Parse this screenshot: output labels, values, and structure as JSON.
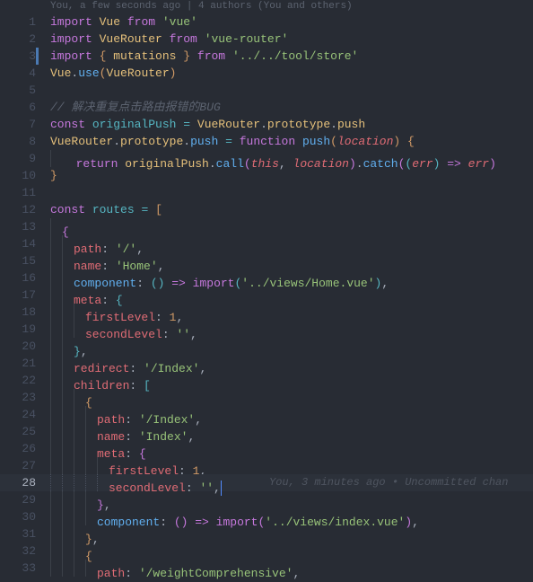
{
  "codelens": "You, a few seconds ago | 4 authors (You and others)",
  "blame_line28": "You, 3 minutes ago • Uncommitted chan",
  "lines": {
    "1": [
      [
        "kw",
        "import"
      ],
      [
        "plain",
        " "
      ],
      [
        "var",
        "Vue"
      ],
      [
        "plain",
        " "
      ],
      [
        "kw",
        "from"
      ],
      [
        "plain",
        " "
      ],
      [
        "str",
        "'vue'"
      ]
    ],
    "2": [
      [
        "kw",
        "import"
      ],
      [
        "plain",
        " "
      ],
      [
        "var",
        "VueRouter"
      ],
      [
        "plain",
        " "
      ],
      [
        "kw",
        "from"
      ],
      [
        "plain",
        " "
      ],
      [
        "str",
        "'vue-router'"
      ]
    ],
    "3": [
      [
        "kw",
        "import"
      ],
      [
        "plain",
        " "
      ],
      [
        "brace-y",
        "{"
      ],
      [
        "plain",
        " "
      ],
      [
        "var",
        "mutations"
      ],
      [
        "plain",
        " "
      ],
      [
        "brace-y",
        "}"
      ],
      [
        "plain",
        " "
      ],
      [
        "kw",
        "from"
      ],
      [
        "plain",
        " "
      ],
      [
        "str",
        "'../../tool/store'"
      ]
    ],
    "4": [
      [
        "var",
        "Vue"
      ],
      [
        "punc",
        "."
      ],
      [
        "func",
        "use"
      ],
      [
        "brace-y",
        "("
      ],
      [
        "var",
        "VueRouter"
      ],
      [
        "brace-y",
        ")"
      ]
    ],
    "5": [],
    "6": [
      [
        "comment",
        "// 解决重复点击路由报错的BUG"
      ]
    ],
    "7": [
      [
        "kw",
        "const"
      ],
      [
        "plain",
        " "
      ],
      [
        "prop",
        "originalPush"
      ],
      [
        "plain",
        " "
      ],
      [
        "op",
        "="
      ],
      [
        "plain",
        " "
      ],
      [
        "var",
        "VueRouter"
      ],
      [
        "punc",
        "."
      ],
      [
        "var",
        "prototype"
      ],
      [
        "punc",
        "."
      ],
      [
        "var",
        "push"
      ]
    ],
    "8": [
      [
        "var",
        "VueRouter"
      ],
      [
        "punc",
        "."
      ],
      [
        "var",
        "prototype"
      ],
      [
        "punc",
        "."
      ],
      [
        "func",
        "push"
      ],
      [
        "plain",
        " "
      ],
      [
        "op",
        "="
      ],
      [
        "plain",
        " "
      ],
      [
        "kw",
        "function"
      ],
      [
        "plain",
        " "
      ],
      [
        "func",
        "push"
      ],
      [
        "brace-y",
        "("
      ],
      [
        "param",
        "location"
      ],
      [
        "brace-y",
        ")"
      ],
      [
        "plain",
        " "
      ],
      [
        "brace-y",
        "{"
      ]
    ],
    "9": [
      [
        "plain",
        "  "
      ],
      [
        "kw",
        "return"
      ],
      [
        "plain",
        " "
      ],
      [
        "var",
        "originalPush"
      ],
      [
        "punc",
        "."
      ],
      [
        "func",
        "call"
      ],
      [
        "brace-p",
        "("
      ],
      [
        "this",
        "this"
      ],
      [
        "punc",
        ", "
      ],
      [
        "param",
        "location"
      ],
      [
        "brace-p",
        ")"
      ],
      [
        "punc",
        "."
      ],
      [
        "func",
        "catch"
      ],
      [
        "brace-p",
        "("
      ],
      [
        "brace-b",
        "("
      ],
      [
        "param",
        "err"
      ],
      [
        "brace-b",
        ")"
      ],
      [
        "plain",
        " "
      ],
      [
        "kw",
        "=>"
      ],
      [
        "plain",
        " "
      ],
      [
        "param",
        "err"
      ],
      [
        "brace-p",
        ")"
      ]
    ],
    "10": [
      [
        "brace-y",
        "}"
      ]
    ],
    "11": [],
    "12": [
      [
        "kw",
        "const"
      ],
      [
        "plain",
        " "
      ],
      [
        "prop",
        "routes"
      ],
      [
        "plain",
        " "
      ],
      [
        "op",
        "="
      ],
      [
        "plain",
        " "
      ],
      [
        "brace-y",
        "["
      ]
    ],
    "13": [
      [
        "brace-p",
        "{"
      ]
    ],
    "14": [
      [
        "key",
        "path"
      ],
      [
        "punc",
        ": "
      ],
      [
        "str",
        "'/'"
      ],
      [
        "punc",
        ","
      ]
    ],
    "15": [
      [
        "key",
        "name"
      ],
      [
        "punc",
        ": "
      ],
      [
        "str",
        "'Home'"
      ],
      [
        "punc",
        ","
      ]
    ],
    "16": [
      [
        "func",
        "component"
      ],
      [
        "punc",
        ": "
      ],
      [
        "brace-b",
        "()"
      ],
      [
        "plain",
        " "
      ],
      [
        "kw",
        "=>"
      ],
      [
        "plain",
        " "
      ],
      [
        "kw",
        "import"
      ],
      [
        "brace-b",
        "("
      ],
      [
        "str",
        "'../views/Home.vue'"
      ],
      [
        "brace-b",
        ")"
      ],
      [
        "punc",
        ","
      ]
    ],
    "17": [
      [
        "key",
        "meta"
      ],
      [
        "punc",
        ": "
      ],
      [
        "brace-b",
        "{"
      ]
    ],
    "18": [
      [
        "key",
        "firstLevel"
      ],
      [
        "punc",
        ": "
      ],
      [
        "num",
        "1"
      ],
      [
        "punc",
        ","
      ]
    ],
    "19": [
      [
        "key",
        "secondLevel"
      ],
      [
        "punc",
        ": "
      ],
      [
        "str",
        "''"
      ],
      [
        "punc",
        ","
      ]
    ],
    "20": [
      [
        "brace-b",
        "}"
      ],
      [
        "punc",
        ","
      ]
    ],
    "21": [
      [
        "key",
        "redirect"
      ],
      [
        "punc",
        ": "
      ],
      [
        "str",
        "'/Index'"
      ],
      [
        "punc",
        ","
      ]
    ],
    "22": [
      [
        "key",
        "children"
      ],
      [
        "punc",
        ": "
      ],
      [
        "brace-b",
        "["
      ]
    ],
    "23": [
      [
        "brace-y",
        "{"
      ]
    ],
    "24": [
      [
        "key",
        "path"
      ],
      [
        "punc",
        ": "
      ],
      [
        "str",
        "'/Index'"
      ],
      [
        "punc",
        ","
      ]
    ],
    "25": [
      [
        "key",
        "name"
      ],
      [
        "punc",
        ": "
      ],
      [
        "str",
        "'Index'"
      ],
      [
        "punc",
        ","
      ]
    ],
    "26": [
      [
        "key",
        "meta"
      ],
      [
        "punc",
        ": "
      ],
      [
        "brace-p",
        "{"
      ]
    ],
    "27": [
      [
        "key",
        "firstLevel"
      ],
      [
        "punc",
        ": "
      ],
      [
        "num",
        "1"
      ],
      [
        "punc",
        ","
      ]
    ],
    "28": [
      [
        "key",
        "secondLevel"
      ],
      [
        "punc",
        ": "
      ],
      [
        "str",
        "''"
      ],
      [
        "punc",
        ","
      ]
    ],
    "29": [
      [
        "brace-p",
        "}"
      ],
      [
        "punc",
        ","
      ]
    ],
    "30": [
      [
        "func",
        "component"
      ],
      [
        "punc",
        ": "
      ],
      [
        "brace-p",
        "()"
      ],
      [
        "plain",
        " "
      ],
      [
        "kw",
        "=>"
      ],
      [
        "plain",
        " "
      ],
      [
        "kw",
        "import"
      ],
      [
        "brace-p",
        "("
      ],
      [
        "str",
        "'../views/index.vue'"
      ],
      [
        "brace-p",
        ")"
      ],
      [
        "punc",
        ","
      ]
    ],
    "31": [
      [
        "brace-y",
        "}"
      ],
      [
        "punc",
        ","
      ]
    ],
    "32": [
      [
        "brace-y",
        "{"
      ]
    ],
    "33": [
      [
        "key",
        "path"
      ],
      [
        "punc",
        ": "
      ],
      [
        "str",
        "'/weightComprehensive'"
      ],
      [
        "punc",
        ","
      ]
    ]
  },
  "indent": {
    "9": 1,
    "13": 1,
    "14": 2,
    "15": 2,
    "16": 2,
    "17": 2,
    "18": 3,
    "19": 3,
    "20": 2,
    "21": 2,
    "22": 2,
    "23": 3,
    "24": 4,
    "25": 4,
    "26": 4,
    "27": 5,
    "28": 5,
    "29": 4,
    "30": 4,
    "31": 3,
    "32": 3,
    "33": 4
  }
}
